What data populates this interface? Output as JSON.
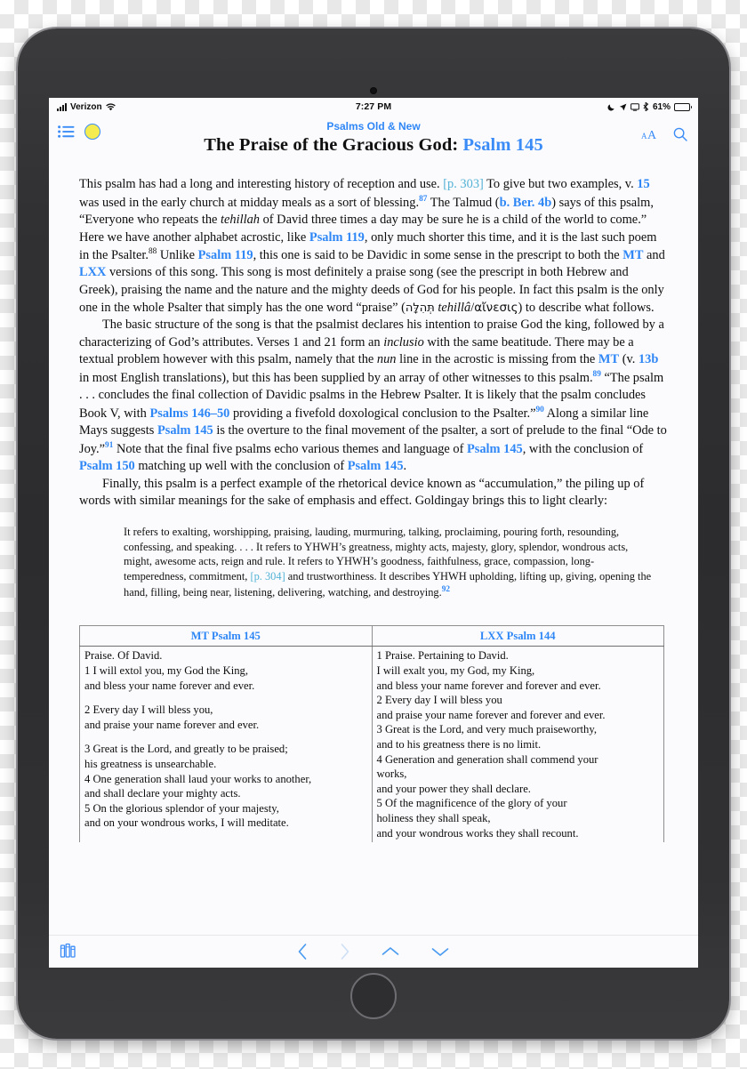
{
  "status_bar": {
    "carrier": "Verizon",
    "time": "7:27 PM",
    "battery_percent": "61%",
    "icons": [
      "cellular-signal-icon",
      "wifi-icon",
      "do-not-disturb-icon",
      "location-arrow-icon",
      "screen-mirroring-icon",
      "bluetooth-icon",
      "battery-icon"
    ]
  },
  "nav_bar": {
    "toc_icon": "list-toc-icon",
    "highlight_icon": "yellow-highlighter-icon",
    "book_name": "Psalms Old & New",
    "chapter_title_main": "The Praise of the Gracious God: ",
    "chapter_title_ref": "Psalm 145",
    "font_size_label": "AA",
    "search_icon": "search-icon"
  },
  "body": {
    "para1": {
      "s1": "This psalm has had a long and interesting history of reception and use. ",
      "pagemark1": "[p. 303]",
      "s2": " To give but two examples, v. ",
      "v15": "15",
      "s3": " was used in the early church at midday meals as a sort of blessing.",
      "fn87": "87",
      "s4": " The Talmud (",
      "bber4b": "b. Ber. 4b",
      "s5": ") says of this psalm, “Everyone who repeats the ",
      "tehillah_it": "tehillah",
      "s6": " of David three times a day may be sure he is a child of the world to come.” Here we have another alphabet acrostic, like ",
      "ps119a": "Psalm 119",
      "s7": ", only much shorter this time, and it is the last such poem in the Psalter.",
      "fn88": "88",
      "s8": " Unlike ",
      "ps119b": "Psalm 119",
      "s9": ", this one is said to be Davidic in some sense in the prescript to both the ",
      "mt1": "MT",
      "s10": " and ",
      "lxx1": "LXX",
      "s11": " versions of this song. This song is most definitely a praise song (see the prescript in both Hebrew and Greek), praising the name and the nature and the mighty deeds of God for his people. In fact this psalm is the only one in the whole Psalter that simply has the one word “praise” (",
      "hebrew": "תְּהִלָּה",
      "translit": "tehillâ",
      "slash": "/",
      "greek": "αἴνεσις",
      "s12": ") to describe what follows."
    },
    "para2": {
      "s1": "The basic structure of the song is that the psalmist declares his intention to praise God the king, followed by a characterizing of God’s attributes. Verses 1 and 21 form an ",
      "inclusio_it": "inclusio",
      "s2": " with the same beatitude. There may be a textual problem however with this psalm, namely that the ",
      "nun_it": "nun",
      "s3": " line in the acrostic is missing from the ",
      "mt2": "MT",
      "s4": " (v. ",
      "v13b": "13b",
      "s5": " in most English translations), but this has been supplied by an array of other witnesses to this psalm.",
      "fn89": "89",
      "s6": " “The psalm . . . concludes the final collection of Davidic psalms in the Hebrew Psalter. It is likely that the psalm concludes Book V, with ",
      "ps146_50": "Psalms 146–50",
      "s7": " providing a fivefold doxological conclusion to the Psalter.”",
      "fn90": "90",
      "s8": " Along a similar line Mays suggests ",
      "ps145a": "Psalm 145",
      "s9": " is the overture to the final movement of the psalter, a sort of prelude to the final “Ode to Joy.”",
      "fn91": "91",
      "s10": " Note that the final five psalms echo various themes and language of ",
      "ps145b": "Psalm 145",
      "s11": ", with the conclusion of ",
      "ps150": "Psalm 150",
      "s12": " matching up well with the conclusion of ",
      "ps145c": "Psalm 145",
      "s13": "."
    },
    "para3": {
      "s1": "Finally, this psalm is a perfect example of the rhetorical device known as “accumulation,” the piling up of words with similar meanings for the sake of emphasis and effect. Goldingay brings this to light clearly:"
    },
    "blockquote": {
      "s1": "It refers to exalting, worshipping, praising, lauding, murmuring, talking, proclaiming, pouring forth, resounding, confessing, and speaking. . . . It refers to YHWH’s greatness, mighty acts, majesty, glory, splendor, wondrous acts, might, awesome acts, reign and rule. It refers to YHWH’s goodness, faithfulness, grace, compassion, long-temperedness, commitment, ",
      "pagemark2": "[p. 304]",
      "s2": " and trustworthiness. It describes YHWH upholding, lifting up, giving, opening the hand, filling, being near, listening, delivering, watching, and destroying.",
      "fn92": "92"
    }
  },
  "table": {
    "headers": [
      "MT Psalm 145",
      "LXX Psalm 144"
    ],
    "left_lines": [
      "Praise. Of David.",
      "1 I will extol you, my God the King,",
      "and bless your name forever and ever.",
      "",
      "2 Every day I will bless you,",
      "and praise your name forever and ever.",
      "",
      "3 Great is the Lord, and greatly to be praised;",
      "his greatness is unsearchable.",
      "4 One generation shall laud your works to another,",
      "and shall declare your mighty acts.",
      "5 On the glorious splendor of your majesty,",
      "and on your wondrous works, I will meditate."
    ],
    "right_lines": [
      "1 Praise. Pertaining to David.",
      "I will exalt you, my God, my King,",
      "and bless your name forever and forever and ever.",
      "2 Every day I will bless you",
      "and praise your name forever and forever and ever.",
      "3 Great is the Lord, and very much praiseworthy,",
      "and to his greatness there is no limit.",
      "4 Generation and generation shall commend your",
      "works,",
      "and your power they shall declare.",
      "5 Of the magnificence of the glory of your",
      "holiness they shall speak,",
      "and your wondrous works they shall recount."
    ]
  },
  "bottom_bar": {
    "library_icon": "library-books-icon",
    "back_icon": "chevron-left-icon",
    "forward_icon": "chevron-right-icon",
    "up_icon": "chevron-up-icon",
    "down_icon": "chevron-down-icon"
  },
  "colors": {
    "accent_blue": "#2f87f6",
    "page_mark": "#53b2d6",
    "highlight_yellow": "#f5ec4f",
    "disabled_grey": "#c9dcf2"
  }
}
